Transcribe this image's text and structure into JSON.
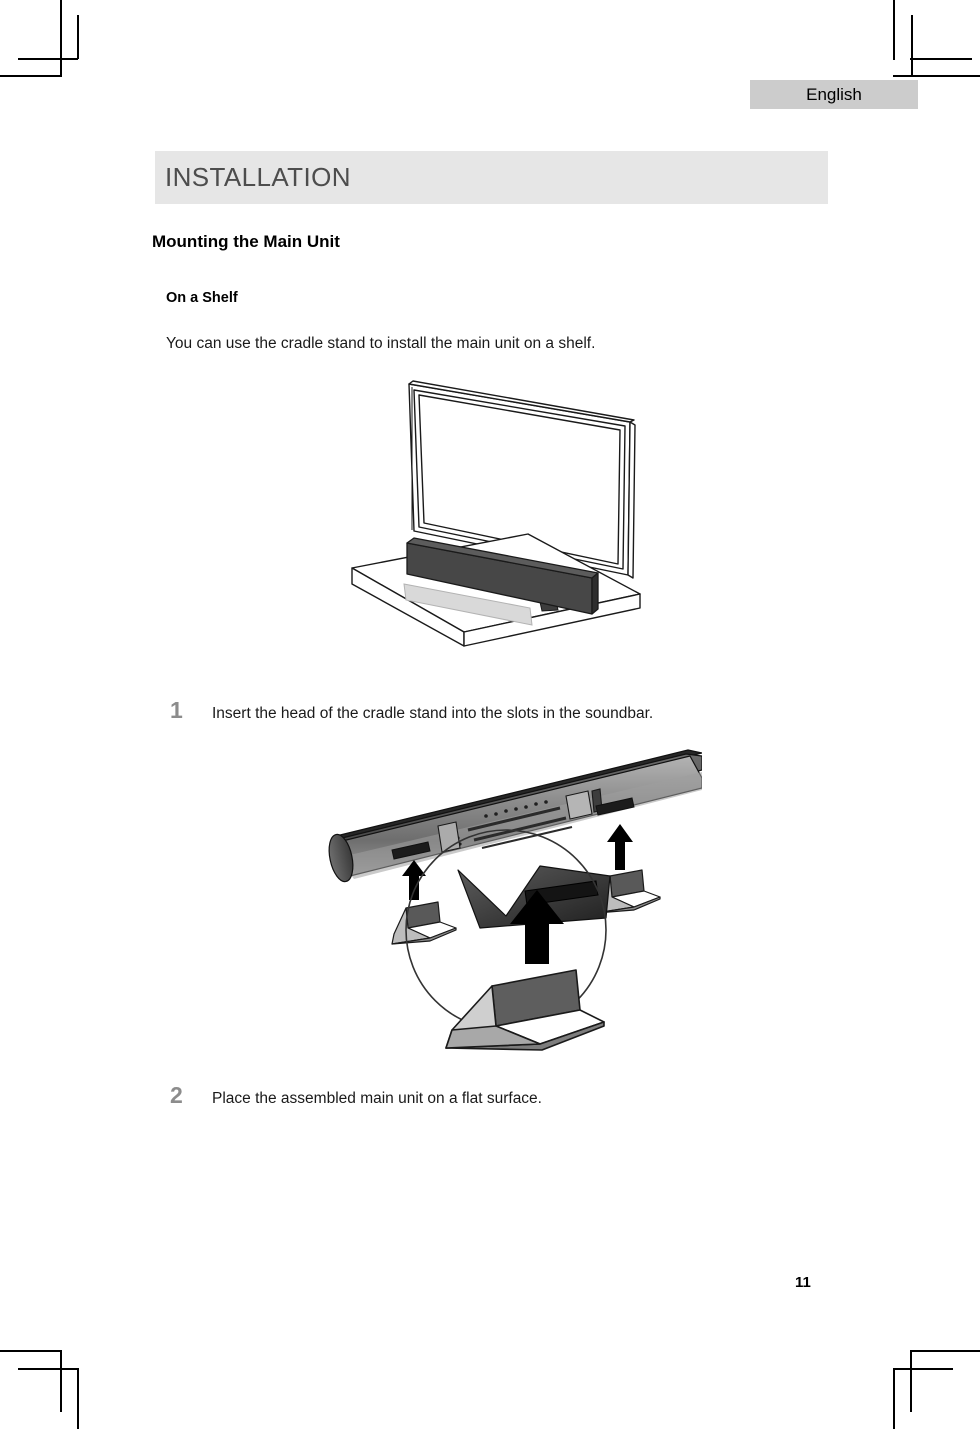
{
  "page": {
    "language_tab": "English",
    "page_number": "11"
  },
  "section": {
    "title": "INSTALLATION",
    "band_color": "#e6e6e6",
    "title_color": "#4d4d4d"
  },
  "content": {
    "heading": "Mounting the Main Unit",
    "subheading": "On a Shelf",
    "intro": "You can use the cradle stand to install the main unit on a shelf.",
    "steps": [
      {
        "number": "1",
        "text": "Insert the head of the cradle stand into the slots in the soundbar."
      },
      {
        "number": "2",
        "text": "Place the assembled main unit on a flat surface."
      }
    ]
  },
  "figures": {
    "shelf": {
      "name": "tv-and-soundbar-on-shelf-illustration",
      "soundbar_color": "#474747",
      "shelf_color": "#ffffff",
      "outline_color": "#1a1a1a"
    },
    "cradle": {
      "name": "soundbar-cradle-stand-insertion-illustration",
      "soundbar_color": "#8c8c8c",
      "stand_color": "#595959",
      "arrow_color": "#000000"
    }
  },
  "crop_marks": {
    "color": "#000000",
    "positions": [
      "top-left",
      "top-right",
      "bottom-left",
      "bottom-right"
    ]
  }
}
